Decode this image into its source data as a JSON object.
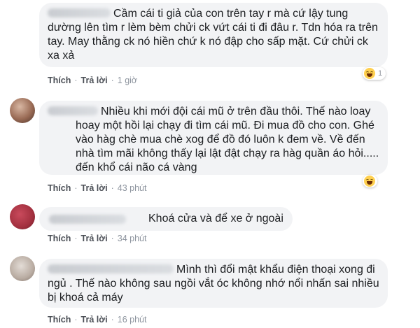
{
  "colors": {
    "bubble_bg": "#f2f3f5",
    "action_link": "#4b4f56",
    "meta_text": "#8d949e",
    "haha_yellow": "#ffd050"
  },
  "comments": [
    {
      "text": "Cầm cái ti giả của con trên tay r mà cứ lậy tung dường lên tìm r lèm bèm chửi ck vứt cái ti đi đâu r. Tdn hóa ra trên tay. May thằng ck nó hiền chứ k nó đập cho sấp mặt. Cứ chửi ck xa xả",
      "like_label": "Thích",
      "reply_label": "Trả lời",
      "time": "1 giờ",
      "reaction_icon": "haha-icon",
      "reaction_count": "1"
    },
    {
      "text": "Nhiều khi mới đội cái mũ ở trên đầu thôi. Thế nào loay hoay một hồi lại chạy đi tìm cái mũ. Đi mua đồ cho con. Ghé vào hàg chè mua chè xog để đồ đó luôn k đem về. Về đến nhà tìm mãi không thấy lại lật đật chạy ra hàg quần áo hỏi..... đến khổ cái não cá vàng",
      "like_label": "Thích",
      "reply_label": "Trả lời",
      "time": "43 phút",
      "reaction_icon": "haha-icon",
      "reaction_count": ""
    },
    {
      "text": "Khoá cửa và để xe ở ngoài",
      "like_label": "Thích",
      "reply_label": "Trả lời",
      "time": "34 phút"
    },
    {
      "text": "Mình thì đổi mật khẩu điện thoại xong đi ngủ . Thế nào không sau ngồi vắt óc không nhớ nổi nhấn sai nhiều bị khoá cả máy",
      "like_label": "Thích",
      "reply_label": "Trả lời",
      "time": "16 phút"
    }
  ]
}
